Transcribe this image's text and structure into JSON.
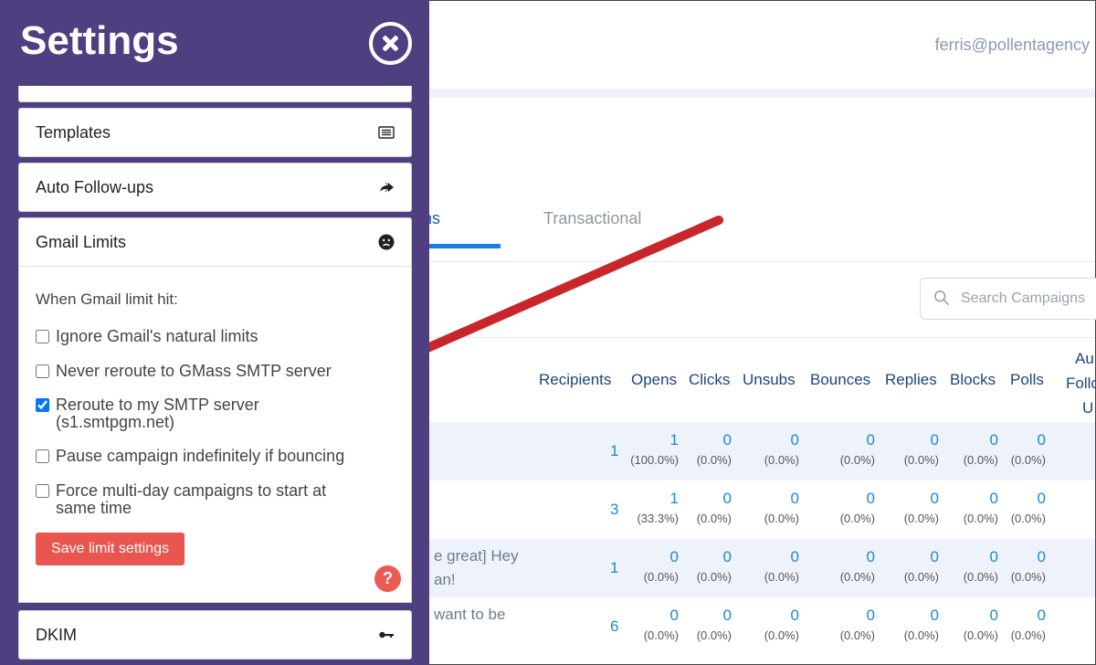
{
  "settings": {
    "title": "Settings",
    "close_icon": "close-icon",
    "sections": {
      "templates": {
        "label": "Templates",
        "icon": "list-icon"
      },
      "followups": {
        "label": "Auto Follow-ups",
        "icon": "forward-arrows-icon"
      },
      "gmail_limits": {
        "label": "Gmail Limits",
        "icon": "sad-face-icon"
      },
      "dkim": {
        "label": "DKIM",
        "icon": "key-icon"
      }
    },
    "limits": {
      "heading": "When Gmail limit hit:",
      "options": [
        {
          "label": "Ignore Gmail's natural limits",
          "checked": false
        },
        {
          "label": "Never reroute to GMass SMTP server",
          "checked": false
        },
        {
          "label": "Reroute to my SMTP server",
          "sub": "(s1.smtpgm.net)",
          "checked": true
        },
        {
          "label": "Pause campaign indefinitely if bouncing",
          "checked": false
        },
        {
          "label": "Force multi-day campaigns to start at same time",
          "checked": false
        }
      ],
      "save_label": "Save limit settings",
      "help_label": "?"
    }
  },
  "app": {
    "user_email": "ferris@pollentagency",
    "tabs": {
      "campaigns": "gns",
      "transactional": "Transactional"
    },
    "search_placeholder": "Search Campaigns",
    "columns": {
      "recipients": "Recipients",
      "opens": "Opens",
      "clicks": "Clicks",
      "unsubs": "Unsubs",
      "bounces": "Bounces",
      "replies": "Replies",
      "blocks": "Blocks",
      "polls": "Polls",
      "auto_1": "Au",
      "auto_2": "Follo",
      "auto_3": "U"
    },
    "rows": [
      {
        "subject_1": "",
        "subject_2": "",
        "recipients": "1",
        "opens": "1",
        "opens_pct": "(100.0%)",
        "clicks": "0",
        "clicks_pct": "(0.0%)",
        "unsubs": "0",
        "unsubs_pct": "(0.0%)",
        "bounces": "0",
        "bounces_pct": "(0.0%)",
        "replies": "0",
        "replies_pct": "(0.0%)",
        "blocks": "0",
        "blocks_pct": "(0.0%)",
        "polls": "0",
        "polls_pct": "(0.0%)"
      },
      {
        "subject_1": "",
        "subject_2": "",
        "recipients": "3",
        "opens": "1",
        "opens_pct": "(33.3%)",
        "clicks": "0",
        "clicks_pct": "(0.0%)",
        "unsubs": "0",
        "unsubs_pct": "(0.0%)",
        "bounces": "0",
        "bounces_pct": "(0.0%)",
        "replies": "0",
        "replies_pct": "(0.0%)",
        "blocks": "0",
        "blocks_pct": "(0.0%)",
        "polls": "0",
        "polls_pct": "(0.0%)"
      },
      {
        "subject_1": "e great] Hey",
        "subject_2": "an!",
        "recipients": "1",
        "opens": "0",
        "opens_pct": "(0.0%)",
        "clicks": "0",
        "clicks_pct": "(0.0%)",
        "unsubs": "0",
        "unsubs_pct": "(0.0%)",
        "bounces": "0",
        "bounces_pct": "(0.0%)",
        "replies": "0",
        "replies_pct": "(0.0%)",
        "blocks": "0",
        "blocks_pct": "(0.0%)",
        "polls": "0",
        "polls_pct": "(0.0%)"
      },
      {
        "subject_1": "want to be",
        "subject_2": "",
        "recipients": "6",
        "opens": "0",
        "opens_pct": "(0.0%)",
        "clicks": "0",
        "clicks_pct": "(0.0%)",
        "unsubs": "0",
        "unsubs_pct": "(0.0%)",
        "bounces": "0",
        "bounces_pct": "(0.0%)",
        "replies": "0",
        "replies_pct": "(0.0%)",
        "blocks": "0",
        "blocks_pct": "(0.0%)",
        "polls": "0",
        "polls_pct": "(0.0%)"
      }
    ]
  },
  "colors": {
    "panel": "#4f3e80",
    "save": "#e9564f",
    "link": "#1e87d6",
    "arrow": "#c8262b"
  }
}
